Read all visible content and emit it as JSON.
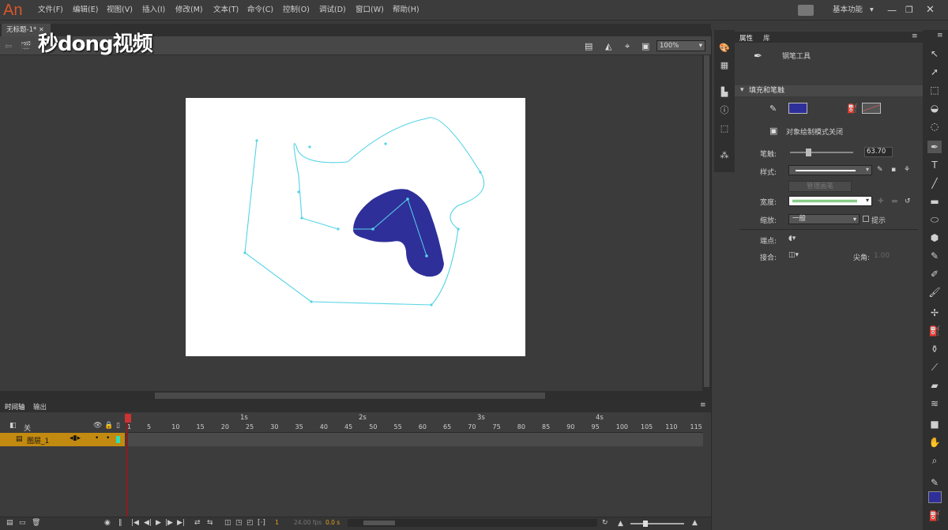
{
  "app": {
    "logo": "An",
    "workspace": "基本功能"
  },
  "menu": [
    "文件(F)",
    "编辑(E)",
    "视图(V)",
    "插入(I)",
    "修改(M)",
    "文本(T)",
    "命令(C)",
    "控制(O)",
    "调试(D)",
    "窗口(W)",
    "帮助(H)"
  ],
  "document": {
    "tab_title": "无标题-1*",
    "zoom": "100%"
  },
  "watermark": "秒dong视频",
  "timeline": {
    "tabs": [
      "时间轴",
      "输出"
    ],
    "layer_header": "关",
    "layer_name": "图层_1",
    "frame_ticks": [
      "1",
      "5",
      "10",
      "15",
      "20",
      "25",
      "30",
      "35",
      "40",
      "45",
      "50",
      "55",
      "60",
      "65",
      "70",
      "75",
      "80",
      "85",
      "90",
      "95",
      "100",
      "105",
      "110",
      "115"
    ],
    "second_labels": [
      "1s",
      "2s",
      "3s",
      "4s"
    ],
    "current_frame": "1",
    "fps": "24.00 fps",
    "time": "0.0 s"
  },
  "properties": {
    "tabs": [
      "属性",
      "库"
    ],
    "tool_name": "钢笔工具",
    "section": "填充和笔触",
    "fill_color": "#2f2f9a",
    "stroke_color": "#e06060",
    "object_draw": "对象绘制模式关闭",
    "stroke_label": "笔触:",
    "stroke_value": "63.70",
    "style_label": "样式:",
    "manage_brushes": "管理画笔",
    "width_label": "宽度:",
    "scale_label": "缩放:",
    "scale_value": "一般",
    "hint_label": "提示",
    "cap_label": "端点:",
    "join_label": "接合:",
    "miter_label": "尖角:",
    "miter_value": "1.00"
  },
  "colors": {
    "accent": "#c28a10",
    "path": "#53d4e6",
    "shape": "#2f2f9a"
  }
}
